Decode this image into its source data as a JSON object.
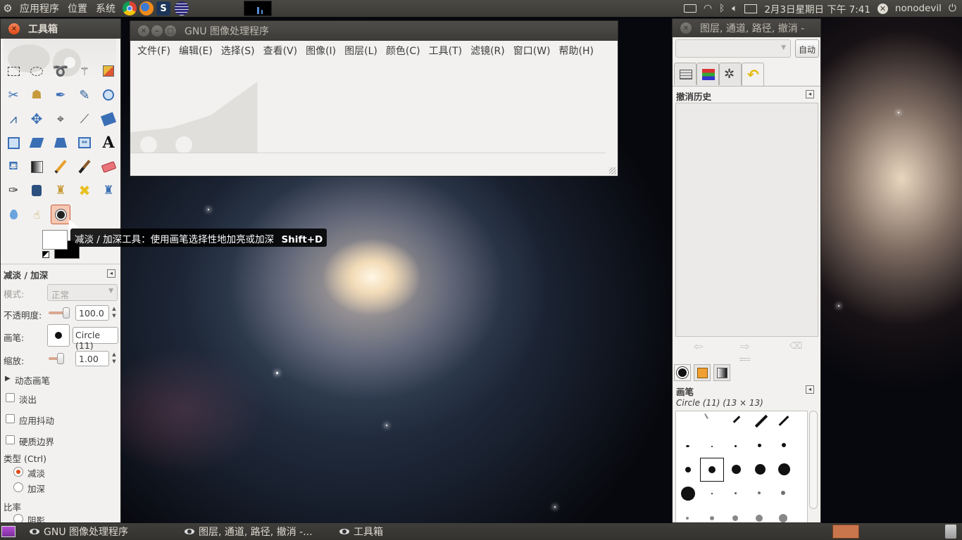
{
  "top_panel": {
    "menu": [
      "应用程序",
      "位置",
      "系统"
    ],
    "datetime": "2月3日星期日 下午 7:41",
    "user": "nonodevil"
  },
  "toolbox": {
    "title": "工具箱",
    "tooltip": {
      "text": "减淡 / 加深工具：使用画笔选择性地加亮或加深",
      "shortcut": "Shift+D"
    },
    "options": {
      "title": "减淡 / 加深",
      "mode_label": "模式:",
      "mode_value": "正常",
      "opacity_label": "不透明度:",
      "opacity_value": "100.0",
      "opacity": 1.0,
      "brush_label": "画笔:",
      "brush_value": "Circle (11)",
      "scale_label": "缩放:",
      "scale_value": "1.00",
      "dynamics_label": "动态画笔",
      "fade_label": "淡出",
      "jitter_label": "应用抖动",
      "hard_edge_label": "硬质边界",
      "type_label": "类型 (Ctrl)",
      "type_dodge": "减淡",
      "type_burn": "加深",
      "ratio_label": "比率",
      "shadows_label": "阴影"
    }
  },
  "main_window": {
    "title": "GNU 图像处理程序",
    "menu": [
      "文件(F)",
      "编辑(E)",
      "选择(S)",
      "查看(V)",
      "图像(I)",
      "图层(L)",
      "颜色(C)",
      "工具(T)",
      "滤镜(R)",
      "窗口(W)",
      "帮助(H)"
    ]
  },
  "dock": {
    "title": "图层, 通道, 路径, 撤消 -",
    "auto_button": "自动",
    "undo_title": "撤消历史",
    "brushes_title": "画笔",
    "brush_info": "Circle (11) (13 × 13)"
  },
  "taskbar": {
    "items": [
      "GNU 图像处理程序",
      "图层, 通道, 路径, 撤消 -...",
      "工具箱"
    ]
  },
  "colors": {
    "accent": "#dd4814",
    "panel": "#3c3b37",
    "window_bg": "#f2f1f0"
  }
}
